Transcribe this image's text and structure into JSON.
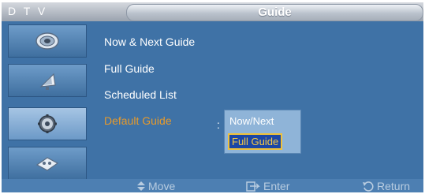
{
  "header": {
    "dtv_label": "D T V",
    "title": "Guide"
  },
  "sidebar": {
    "icons": [
      {
        "name": "picture-icon"
      },
      {
        "name": "sound-icon"
      },
      {
        "name": "setup-icon"
      },
      {
        "name": "input-icon"
      }
    ]
  },
  "menu": {
    "items": [
      {
        "label": "Now & Next Guide"
      },
      {
        "label": "Full Guide"
      },
      {
        "label": "Scheduled List"
      },
      {
        "label": "Default Guide",
        "highlighted": true
      }
    ],
    "separator": ":"
  },
  "popup": {
    "options": [
      {
        "label": "Now/Next"
      },
      {
        "label": "Full Guide",
        "selected": true
      }
    ]
  },
  "footer": {
    "move_label": "Move",
    "enter_label": "Enter",
    "return_label": "Return"
  },
  "colors": {
    "background": "#3f72a6",
    "highlight_text": "#e69a2c",
    "selected_option": "#1b47a6"
  }
}
